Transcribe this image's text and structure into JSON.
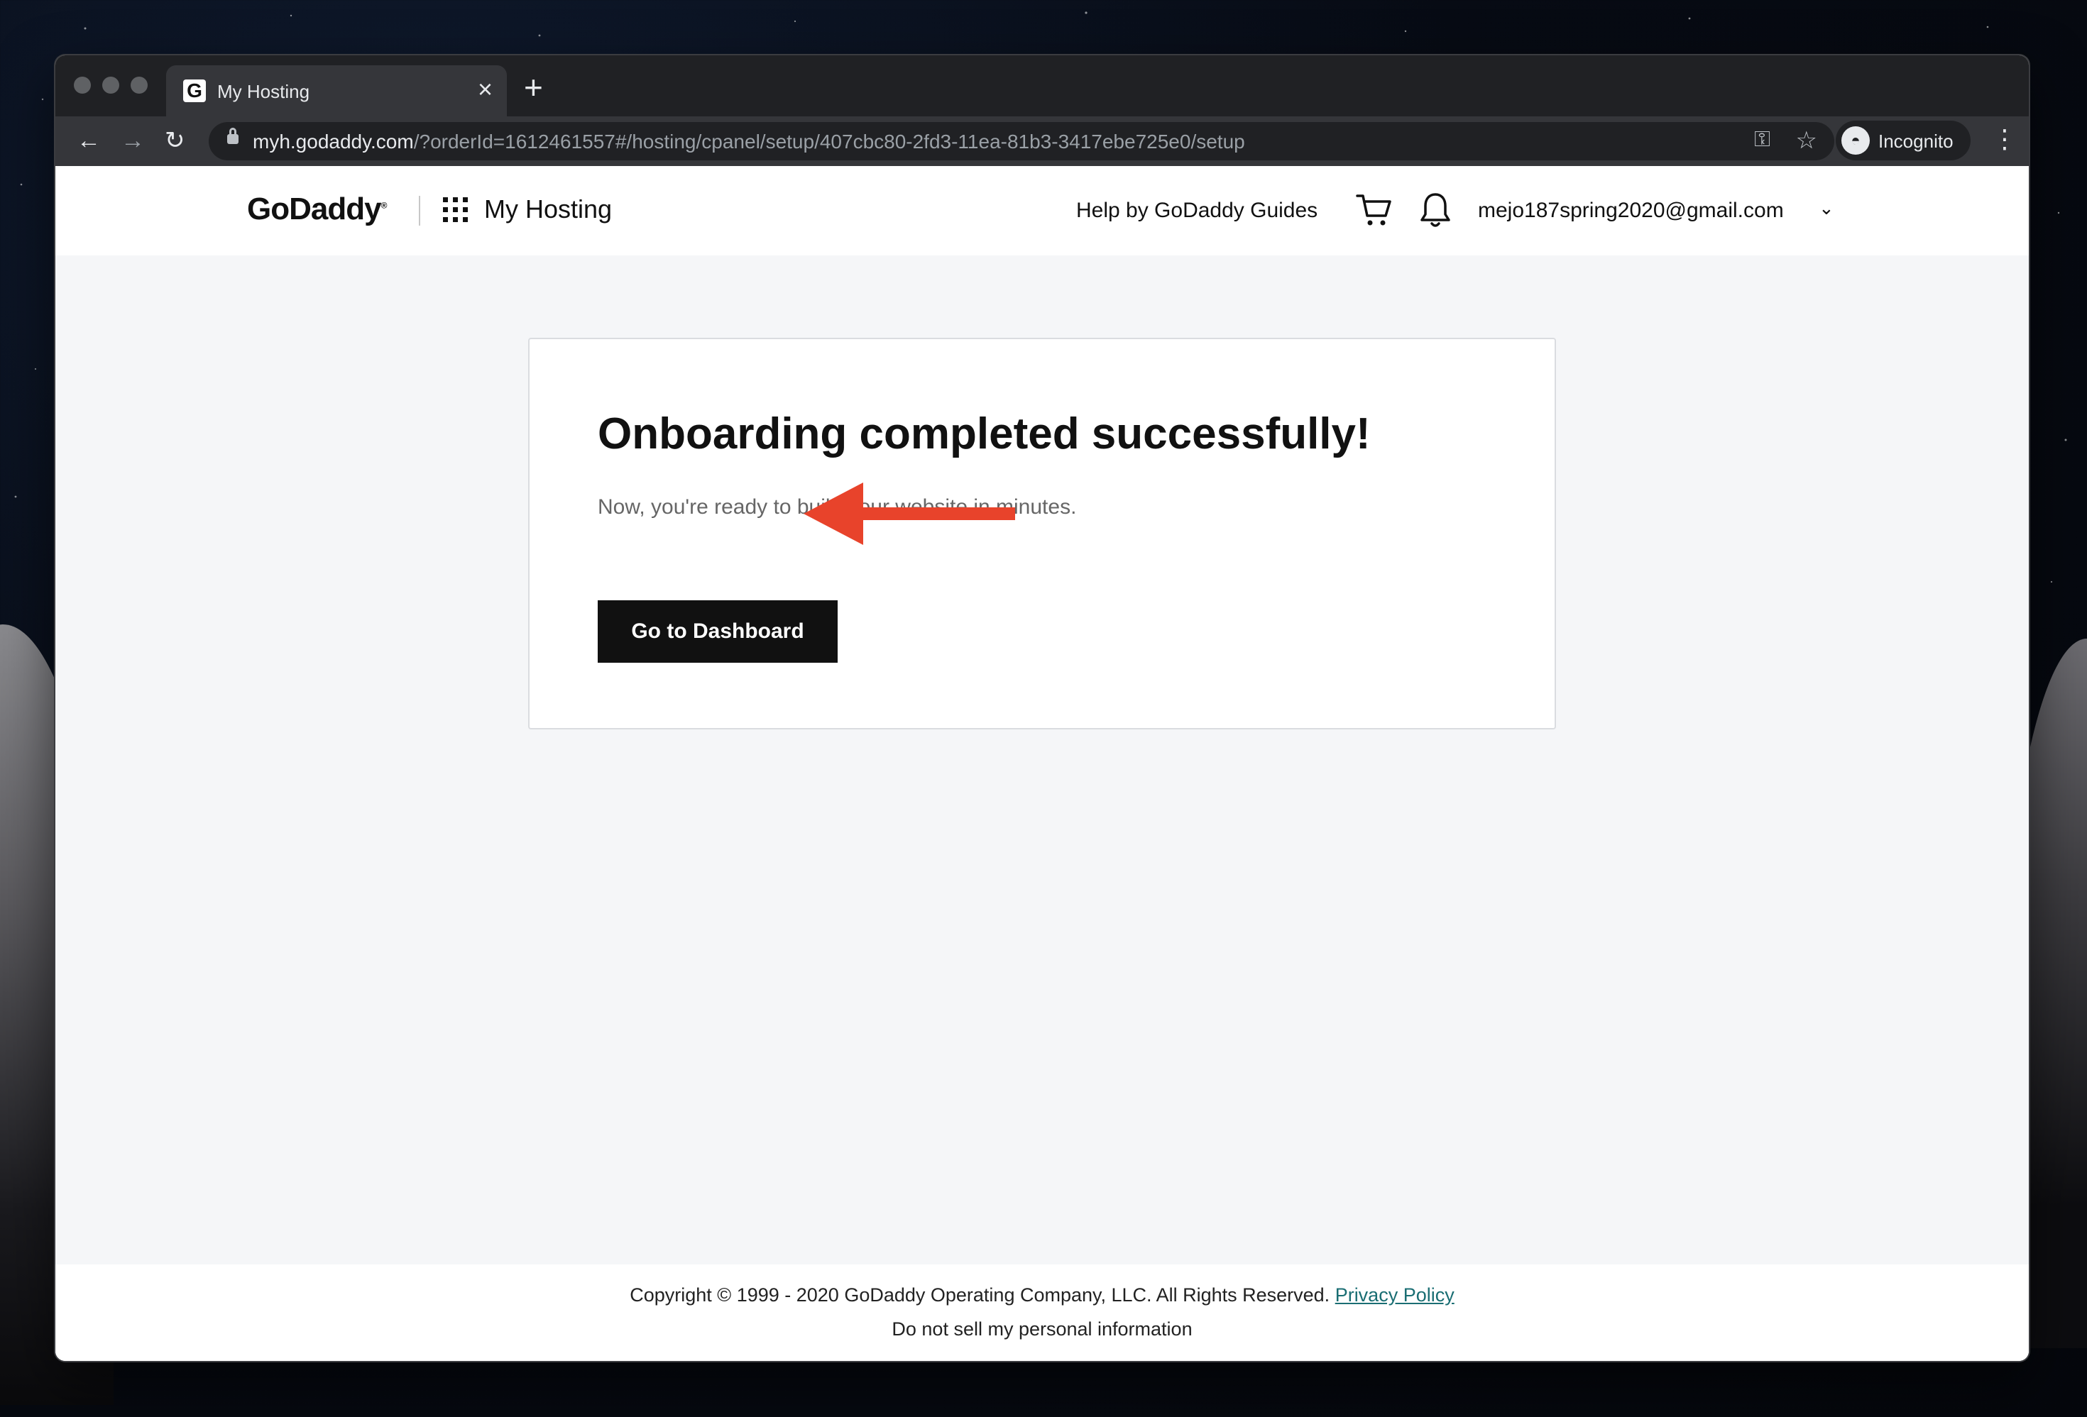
{
  "browser": {
    "tab_title": "My Hosting",
    "tab_favicon": "G",
    "url_host": "myh.godaddy.com",
    "url_path": "/?orderId=1612461557#/hosting/cpanel/setup/407cbc80-2fd3-11ea-81b3-3417ebe725e0/setup",
    "incognito_label": "Incognito"
  },
  "header": {
    "logo": "GoDaddy",
    "app_title": "My Hosting",
    "help_link": "Help by GoDaddy Guides",
    "account_email": "mejo187spring2020@gmail.com"
  },
  "card": {
    "title": "Onboarding completed successfully!",
    "subtitle": "Now, you're ready to build your website in minutes.",
    "button_label": "Go to Dashboard"
  },
  "footer": {
    "copyright": "Copyright © 1999 - 2020 GoDaddy Operating Company, LLC. All Rights Reserved.",
    "privacy_link": "Privacy Policy",
    "do_not_sell": "Do not sell my personal information"
  },
  "colors": {
    "annotation_arrow": "#e8432b",
    "button_bg": "#111111",
    "link": "#1a6e73"
  }
}
